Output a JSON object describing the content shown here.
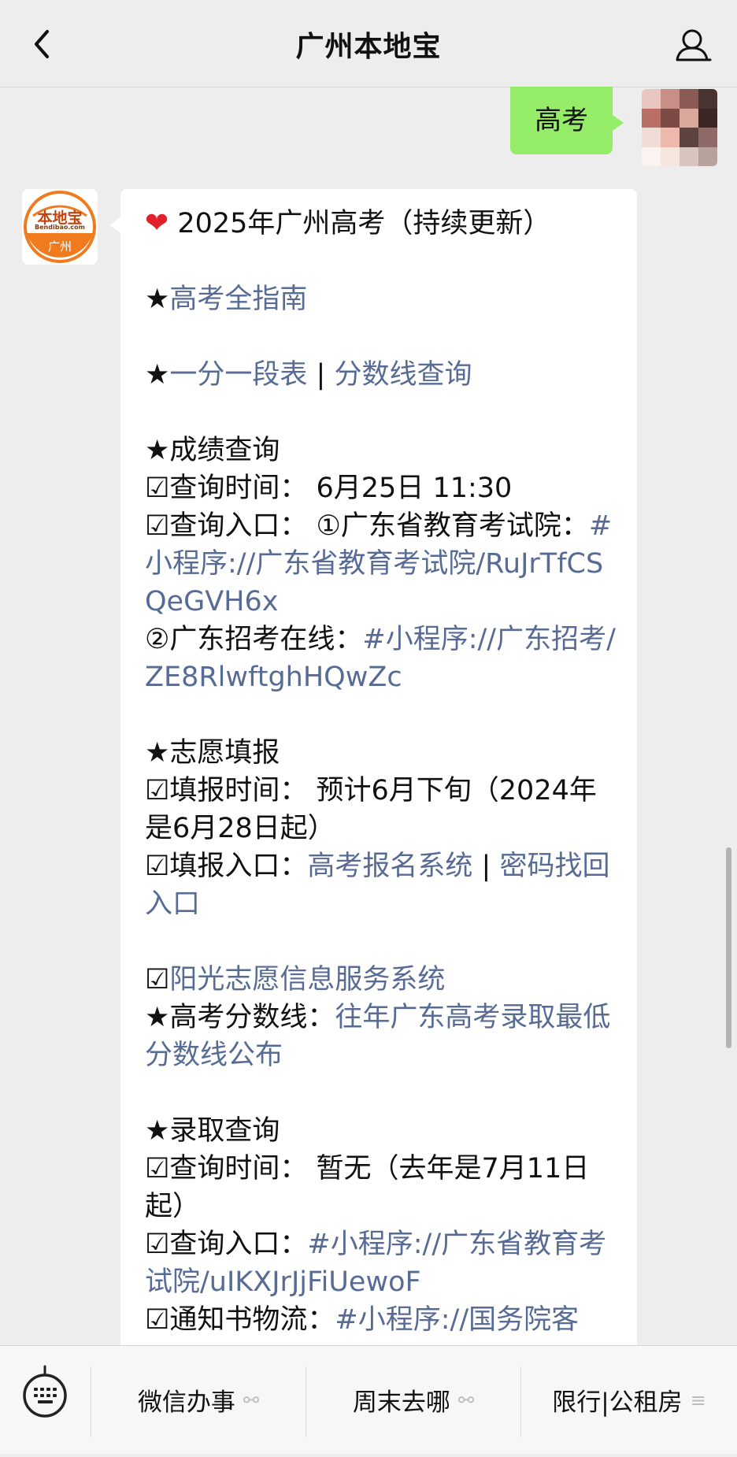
{
  "header": {
    "title": "广州本地宝"
  },
  "out_message": {
    "text": "高考"
  },
  "bot_logo": {
    "top_text": "本地宝",
    "sub_text": "Bendibao.com",
    "city": "广州"
  },
  "message": {
    "title": "2025年广州高考（持续更新）",
    "star": "★",
    "check": "☑",
    "guide_link": "高考全指南",
    "score_table_link": "一分一段表",
    "pipe": " | ",
    "score_line_link": "分数线查询",
    "results_heading": "成绩查询",
    "results_time": "查询时间：  6月25日 11:30",
    "results_entry_label": "查询入口：  ①广东省教育考试院：",
    "results_entry_link1": "#小程序://广东省教育考试院/RuJrTfCSQeGVH6x",
    "results_entry2_label": "②广东招考在线：",
    "results_entry_link2": "#小程序://广东招考/ZE8RlwftghHQwZc",
    "volunteer_heading": "志愿填报",
    "volunteer_time": "填报时间：  预计6月下旬（2024年是6月28日起）",
    "volunteer_entry_label": "填报入口：",
    "volunteer_entry_link1": "高考报名系统",
    "volunteer_entry_sep": "  | ",
    "volunteer_entry_link2": "密码找回入口",
    "sunshine_link": "阳光志愿信息服务系统",
    "scoreline_label": "高考分数线：",
    "scoreline_link": "往年广东高考录取最低分数线公布",
    "admission_heading": "录取查询",
    "admission_time": "查询时间：  暂无（去年是7月11日起）",
    "admission_entry_label": "查询入口：",
    "admission_entry_link": "#小程序://广东省教育考试院/uIKXJrJjFiUewoF",
    "notice_label": "通知书物流：",
    "notice_link": "#小程序://国务院客"
  },
  "bottom_menu": {
    "items": [
      {
        "label": "微信办事",
        "icon": "link-icon"
      },
      {
        "label": "周末去哪",
        "icon": "link-icon"
      },
      {
        "label": "限行|公租房",
        "icon": "menu-lines-icon"
      }
    ]
  },
  "colors": {
    "background": "#ededed",
    "out_bubble": "#95ec69",
    "link": "#576b95",
    "logo_orange": "#f07b1e"
  }
}
